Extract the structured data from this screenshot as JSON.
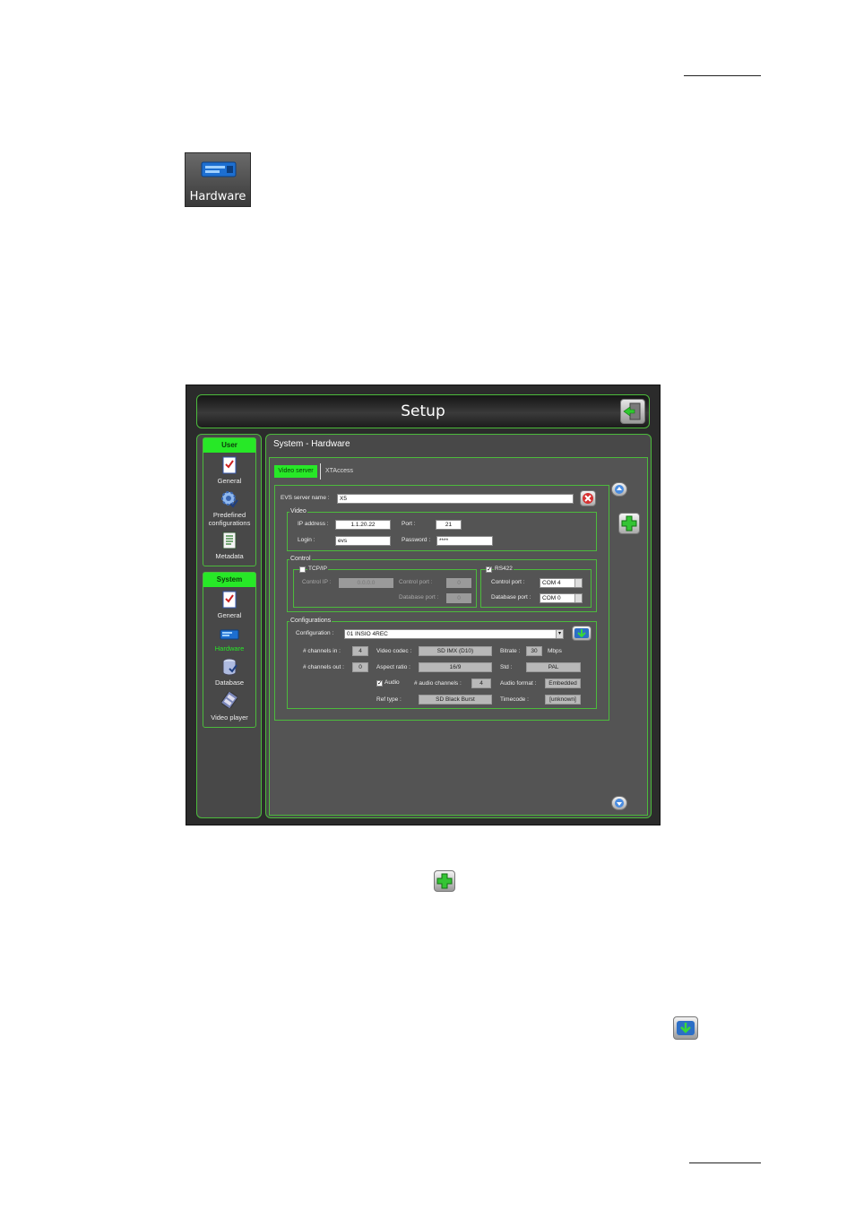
{
  "tile": {
    "label": "Hardware",
    "icon": "hardware-icon"
  },
  "setup": {
    "title": "Setup",
    "sidebar": {
      "user_header": "User",
      "user_items": [
        {
          "label": "General",
          "icon": "checklist-icon"
        },
        {
          "label": "Predefined configurations",
          "icon": "gear-check-icon"
        },
        {
          "label": "Metadata",
          "icon": "document-icon"
        }
      ],
      "system_header": "System",
      "system_items": [
        {
          "label": "General",
          "icon": "checklist-icon"
        },
        {
          "label": "Hardware",
          "icon": "hardware-icon"
        },
        {
          "label": "Database",
          "icon": "database-icon"
        },
        {
          "label": "Video player",
          "icon": "film-icon"
        }
      ]
    },
    "page_title": "System - Hardware",
    "tabs": [
      "Video server",
      "XTAccess"
    ],
    "server_name_label": "EVS server name :",
    "server_name": "X5",
    "video": {
      "legend": "Video",
      "ip_label": "IP address :",
      "ip": "1.1.20.22",
      "port_label": "Port :",
      "port": "21",
      "login_label": "Login :",
      "login": "evs",
      "password_label": "Password :",
      "password": "****"
    },
    "control": {
      "legend": "Control",
      "tcpip_label": "TCP/IP",
      "control_ip_label": "Control IP :",
      "control_ip": "0.0.0.0",
      "control_port_label": "Control port :",
      "control_port": "0",
      "database_port_label": "Database port :",
      "database_port": "0",
      "rs422_label": "RS422",
      "rs_control_port_label": "Control port :",
      "rs_control_port": "COM 4",
      "rs_database_port_label": "Database port :",
      "rs_database_port": "COM 0"
    },
    "configurations": {
      "legend": "Configurations",
      "configuration_label": "Configuration :",
      "configuration": "01 INSIO 4REC",
      "channels_in_label": "# channels in :",
      "channels_in": "4",
      "channels_out_label": "# channels out :",
      "channels_out": "0",
      "video_codec_label": "Video codec :",
      "video_codec": "SD IMX (D10)",
      "aspect_ratio_label": "Aspect ratio :",
      "aspect_ratio": "16/9",
      "bitrate_label": "Bitrate :",
      "bitrate": "30",
      "bitrate_unit": "Mbps",
      "std_label": "Std :",
      "std": "PAL",
      "audio_label": "Audio",
      "audio_channels_label": "# audio channels :",
      "audio_channels": "4",
      "audio_format_label": "Audio format :",
      "audio_format": "Embedded",
      "ref_type_label": "Ref type :",
      "ref_type": "SD Black Burst",
      "timecode_label": "Timecode :",
      "timecode": "[unknown]"
    }
  },
  "colors": {
    "accent_green": "#27e827",
    "border_green": "#4cbb3c",
    "panel_gray": "#545454"
  }
}
